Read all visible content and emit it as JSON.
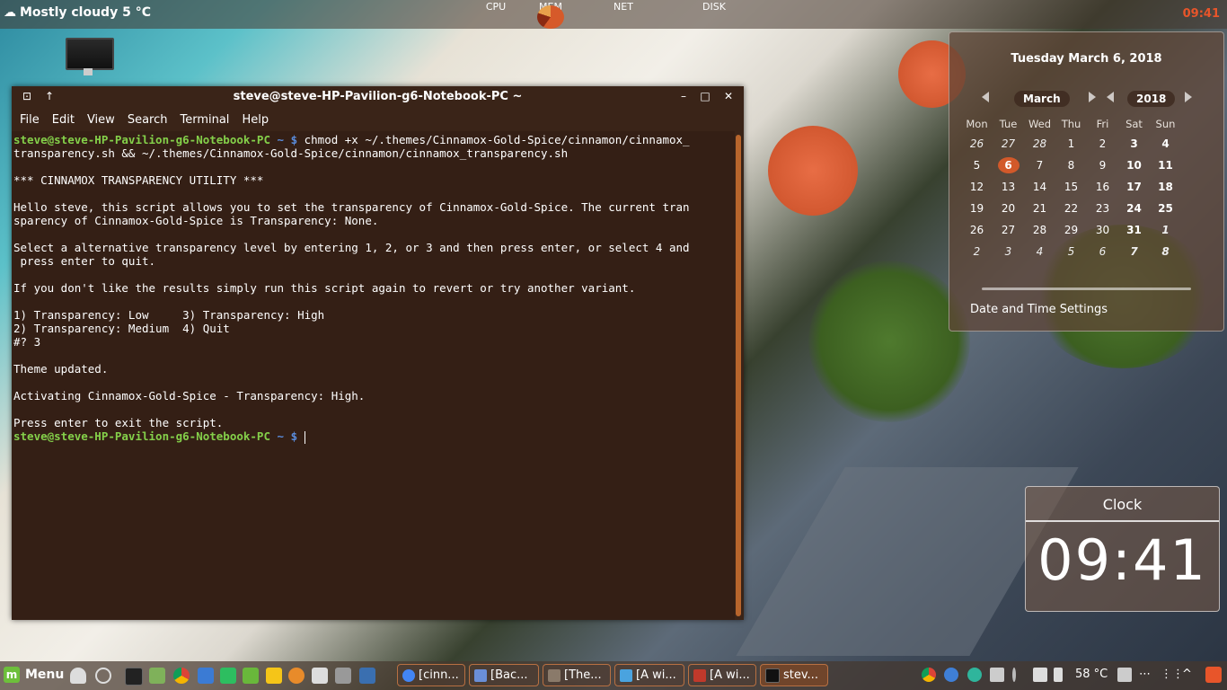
{
  "top_panel": {
    "weather": "Mostly cloudy 5 °C",
    "monitors": [
      "CPU",
      "MEM",
      "NET",
      "DISK"
    ],
    "clock": "09:41"
  },
  "terminal": {
    "title": "steve@steve-HP-Pavilion-g6-Notebook-PC ~",
    "menu": [
      "File",
      "Edit",
      "View",
      "Search",
      "Terminal",
      "Help"
    ],
    "prompt_user": "steve@steve-HP-Pavilion-g6-Notebook-PC",
    "prompt_dir": "~ $",
    "command": "chmod +x ~/.themes/Cinnamox-Gold-Spice/cinnamon/cinnamox_",
    "command_cont": "transparency.sh && ~/.themes/Cinnamox-Gold-Spice/cinnamon/cinnamox_transparency.sh",
    "output": [
      "",
      "*** CINNAMOX TRANSPARENCY UTILITY ***",
      "",
      "Hello steve, this script allows you to set the transparency of Cinnamox-Gold-Spice. The current tran",
      "sparency of Cinnamox-Gold-Spice is Transparency: None.",
      "",
      "Select a alternative transparency level by entering 1, 2, or 3 and then press enter, or select 4 and",
      " press enter to quit.",
      "",
      "If you don't like the results simply run this script again to revert or try another variant.",
      "",
      "1) Transparency: Low     3) Transparency: High",
      "2) Transparency: Medium  4) Quit",
      "#? 3",
      "",
      "Theme updated.",
      "",
      "Activating Cinnamox-Gold-Spice - Transparency: High.",
      "",
      "Press enter to exit the script."
    ]
  },
  "calendar": {
    "date_header": "Tuesday March 6, 2018",
    "month": "March",
    "year": "2018",
    "weekdays": [
      "Mon",
      "Tue",
      "Wed",
      "Thu",
      "Fri",
      "Sat",
      "Sun"
    ],
    "weeks": [
      [
        "26",
        "27",
        "28",
        "1",
        "2",
        "3",
        "4"
      ],
      [
        "5",
        "6",
        "7",
        "8",
        "9",
        "10",
        "11"
      ],
      [
        "12",
        "13",
        "14",
        "15",
        "16",
        "17",
        "18"
      ],
      [
        "19",
        "20",
        "21",
        "22",
        "23",
        "24",
        "25"
      ],
      [
        "26",
        "27",
        "28",
        "29",
        "30",
        "31",
        "1"
      ],
      [
        "2",
        "3",
        "4",
        "5",
        "6",
        "7",
        "8"
      ]
    ],
    "today": "6",
    "settings_link": "Date and Time Settings"
  },
  "clock_desklet": {
    "title": "Clock",
    "time": "09:41"
  },
  "bottom_panel": {
    "menu_label": "Menu",
    "tasks": [
      "[cinn...",
      "[Bac...",
      "[The...",
      "[A wi...",
      "[A wi...",
      "stev..."
    ],
    "temperature": "58 °C"
  },
  "colors": {
    "accent": "#d2592a",
    "terminal_bg": "#341f15",
    "prompt_user": "#84d04a",
    "prompt_dir": "#5a8cdc"
  }
}
